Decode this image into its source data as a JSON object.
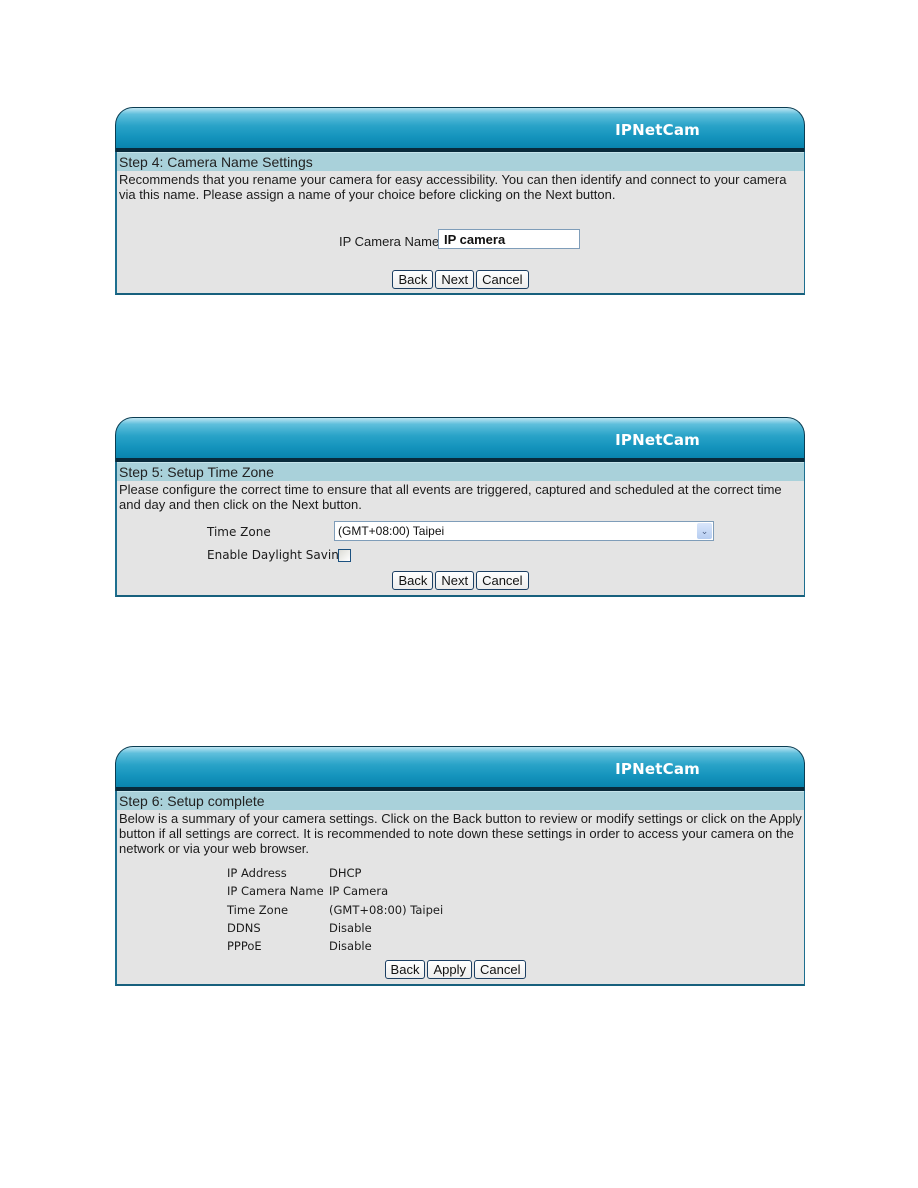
{
  "brand": "IPNetCam",
  "step4": {
    "title": "Step 4: Camera Name Settings",
    "description": "Recommends that you rename your camera for easy accessibility. You can then identify and connect to your camera via this name. Please assign a name of your choice before clicking on the Next button.",
    "field_label": "IP Camera Name",
    "field_value": "IP camera",
    "buttons": {
      "back": "Back",
      "next": "Next",
      "cancel": "Cancel"
    }
  },
  "step5": {
    "title": "Step 5: Setup Time Zone",
    "description": "Please configure the correct time to ensure that all events are triggered, captured and scheduled at the correct time and day and then click on the Next button.",
    "timezone_label": "Time Zone",
    "timezone_value": "(GMT+08:00) Taipei",
    "dst_label": "Enable Daylight Saving",
    "dst_checked": false,
    "buttons": {
      "back": "Back",
      "next": "Next",
      "cancel": "Cancel"
    }
  },
  "step6": {
    "title": "Step 6: Setup complete",
    "description": "Below is a summary of your camera settings. Click on the Back button to review or modify settings or click on the Apply button if all settings are correct. It is recommended to note down these settings in order to access your camera on the network or via your web browser.",
    "summary": [
      {
        "label": "IP Address",
        "value": "DHCP"
      },
      {
        "label": "IP Camera Name",
        "value": "IP Camera"
      },
      {
        "label": "Time Zone",
        "value": "(GMT+08:00) Taipei"
      },
      {
        "label": "DDNS",
        "value": "Disable"
      },
      {
        "label": "PPPoE",
        "value": "Disable"
      }
    ],
    "buttons": {
      "back": "Back",
      "apply": "Apply",
      "cancel": "Cancel"
    }
  }
}
